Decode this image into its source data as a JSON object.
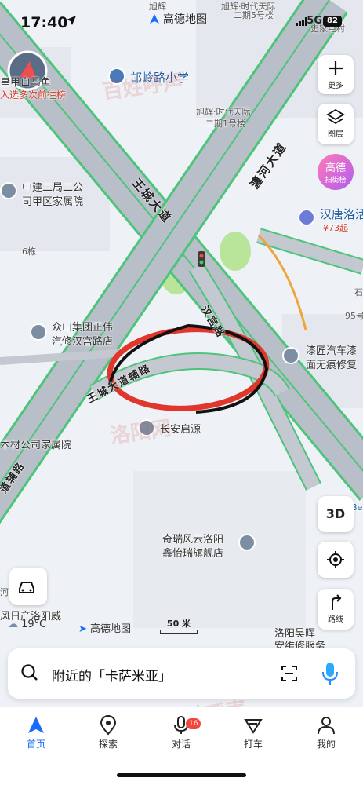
{
  "status_bar": {
    "time": "17:40",
    "app_title": "高德地图",
    "network": "5G",
    "battery": "82"
  },
  "map_labels": {
    "xuhui_top": "旭辉",
    "xuhui_tianyu_5": "旭辉·时代天际",
    "xuhui_tianyu_5b": "二期5号楼",
    "qiuling_school": "邙岭路小学",
    "xuhui_tianyu_1": "旭辉·时代天际",
    "xuhui_tianyu_1b": "二期1号楼",
    "zhongjian_1": "中建二局二公",
    "zhongjian_2": "司甲区家属院",
    "wangcheng_road": "王城大道",
    "chanhe_road": "瀍河大道",
    "hantang_1": "汉唐洛活",
    "hantang_price": "¥73起",
    "hangong_road": "汉宫路",
    "zhongshan_1": "众山集团正伟",
    "zhongshan_2": "汽修汉宫路店",
    "qijiang_1": "漆匠汽车漆",
    "qijiang_2": "面无痕修复",
    "aux_road": "王城大道辅路",
    "changan": "长安启源",
    "building6": "6栋",
    "material_co": "木材公司家属院",
    "aux_road_left": "道辅路",
    "qirui_1": "奇瑞风云洛阳",
    "qirui_2": "鑫怡瑞旗舰店",
    "luoyang_hao_1": "洛阳昊晖",
    "luoyang_hao_2": "安维修服务",
    "fengri_1": "风日产洛阳威",
    "fengri_2": "威",
    "he": "河",
    "num95": "95号",
    "shi": "石",
    "be": "Be",
    "shijia": "史家屯村",
    "huang_1": "皇甲白马鱼",
    "huang_2": "入选多次前往榜"
  },
  "right_buttons": {
    "more": "更多",
    "layers": "图层",
    "gaode_rank_1": "高德",
    "gaode_rank_2": "扫街榜",
    "three_d": "3D",
    "route": "路线"
  },
  "map_footer": {
    "weather": "19°C",
    "brand": "高德地图",
    "scale": "50 米"
  },
  "search": {
    "text": "附近的「卡萨米亚」"
  },
  "tabs": [
    {
      "label": "首页"
    },
    {
      "label": "探索"
    },
    {
      "label": "对话"
    },
    {
      "label": "打车"
    },
    {
      "label": "我的"
    }
  ],
  "badge_count": "16",
  "watermarks": [
    "百姓呼声",
    "洛阳网",
    "百姓呼声"
  ],
  "colors": {
    "accent": "#1a6cff",
    "road_green": "#4cc47a",
    "annotation_red": "#e0362c"
  }
}
